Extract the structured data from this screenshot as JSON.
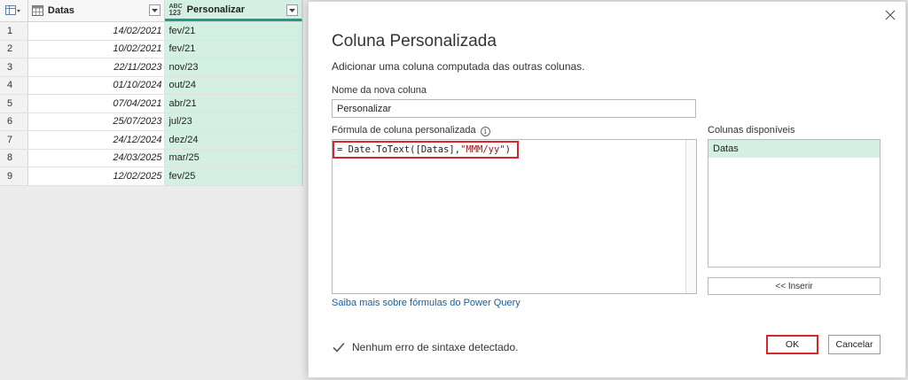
{
  "grid": {
    "columns": [
      {
        "name": "Datas",
        "type_icon": "calendar-icon"
      },
      {
        "name": "Personalizar",
        "type_icon": "abc-123-icon",
        "type_top": "ABC",
        "type_bottom": "123"
      }
    ],
    "rows": [
      {
        "n": "1",
        "date": "14/02/2021",
        "custom": "fev/21"
      },
      {
        "n": "2",
        "date": "10/02/2021",
        "custom": "fev/21"
      },
      {
        "n": "3",
        "date": "22/11/2023",
        "custom": "nov/23"
      },
      {
        "n": "4",
        "date": "01/10/2024",
        "custom": "out/24"
      },
      {
        "n": "5",
        "date": "07/04/2021",
        "custom": "abr/21"
      },
      {
        "n": "6",
        "date": "25/07/2023",
        "custom": "jul/23"
      },
      {
        "n": "7",
        "date": "24/12/2024",
        "custom": "dez/24"
      },
      {
        "n": "8",
        "date": "24/03/2025",
        "custom": "mar/25"
      },
      {
        "n": "9",
        "date": "12/02/2025",
        "custom": "fev/25"
      }
    ]
  },
  "dialog": {
    "title": "Coluna Personalizada",
    "subtitle": "Adicionar uma coluna computada das outras colunas.",
    "name_label": "Nome da nova coluna",
    "name_value": "Personalizar",
    "formula_label": "Fórmula de coluna personalizada",
    "formula_prefix": "= Date.ToText([Datas],",
    "formula_string": "\"MMM/yy\"",
    "formula_suffix": ")",
    "available_label": "Colunas disponíveis",
    "available_columns": [
      "Datas"
    ],
    "insert_label": "<< Inserir",
    "learn_link": "Saiba mais sobre fórmulas do Power Query",
    "status": "Nenhum erro de sintaxe detectado.",
    "ok_label": "OK",
    "cancel_label": "Cancelar"
  },
  "colors": {
    "accent_green": "#14a187",
    "selected_bg": "#d4f0e3",
    "highlight_red": "#d9262c",
    "link": "#1a5d96"
  }
}
